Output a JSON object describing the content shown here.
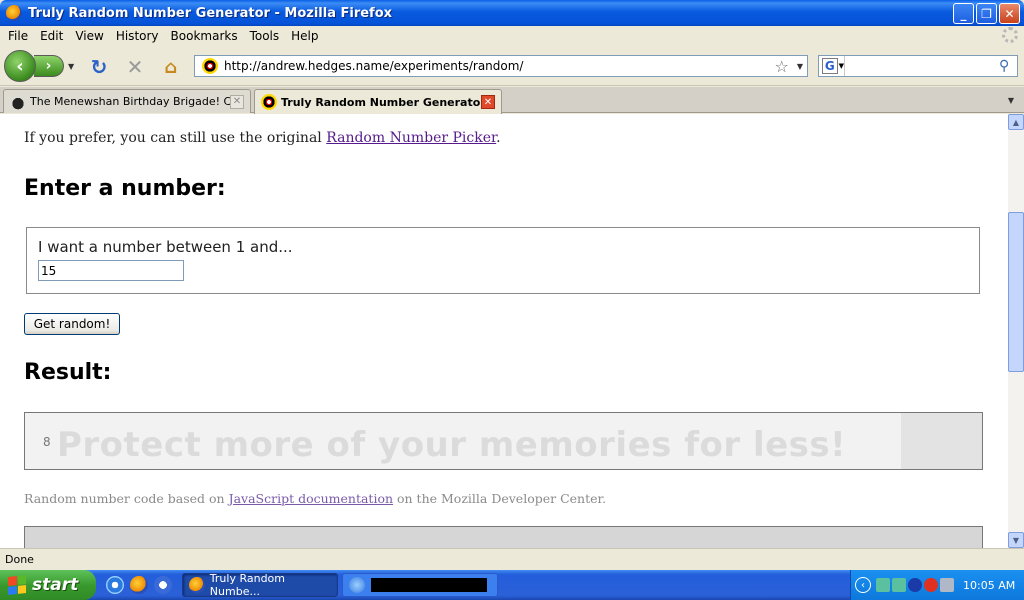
{
  "window": {
    "title": "Truly Random Number Generator - Mozilla Firefox",
    "minimize": "_",
    "maximize": "❐",
    "close": "✕"
  },
  "menu": [
    "File",
    "Edit",
    "View",
    "History",
    "Bookmarks",
    "Tools",
    "Help"
  ],
  "nav": {
    "url": "http://andrew.hedges.name/experiments/random/",
    "search_value": ""
  },
  "tabs": [
    {
      "label": "The Menewshan Birthday Brigade! Com...",
      "active": false
    },
    {
      "label": "Truly Random Number Generator",
      "active": true
    }
  ],
  "page": {
    "intro_before": "If you prefer, you can still use the original ",
    "intro_link": "Random Number Picker",
    "intro_after": ".",
    "enter_heading": "Enter a number:",
    "field_label": "I want a number between 1 and...",
    "field_value": "15",
    "button_label": "Get random!",
    "result_heading": "Result:",
    "result_value": "8",
    "watermark": "Protect more of your memories for less!",
    "footnote_before": "Random number code based on ",
    "footnote_link": "JavaScript documentation",
    "footnote_after": " on the Mozilla Developer Center."
  },
  "status": {
    "text": "Done"
  },
  "taskbar": {
    "start_label": "start",
    "firefox_task": "Truly Random Numbe...",
    "clock": "10:05 AM"
  },
  "colors": {
    "link_visited": "#551a8b",
    "titlebar_blue": "#0a5ae0",
    "start_green": "#3a9a2e"
  }
}
